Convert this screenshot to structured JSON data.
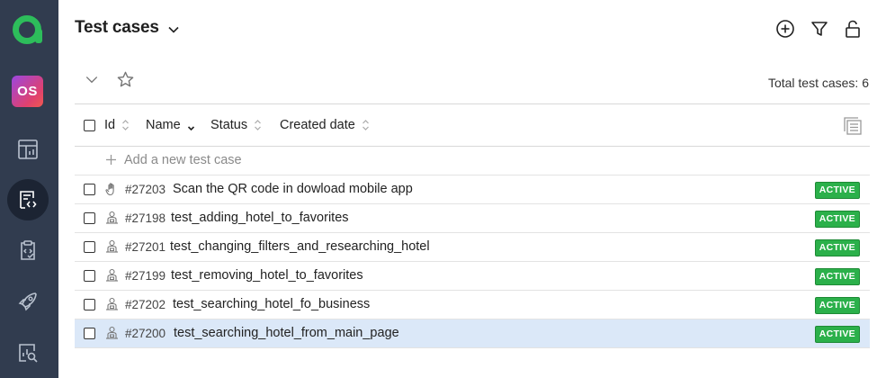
{
  "sidebar": {
    "avatar_initials": "OS",
    "brand_color": "#2dbd5b",
    "items": [
      {
        "icon": "dashboard-icon"
      },
      {
        "icon": "test-cases-icon",
        "active": true
      },
      {
        "icon": "test-plans-icon"
      },
      {
        "icon": "launches-icon"
      },
      {
        "icon": "analytics-search-icon"
      }
    ]
  },
  "header": {
    "title": "Test cases",
    "actions": [
      "add-icon",
      "filter-icon",
      "unlock-icon"
    ]
  },
  "toolbar": {
    "total_label": "Total test cases: 6"
  },
  "table": {
    "columns": [
      "Id",
      "Name",
      "Status",
      "Created date"
    ],
    "add_label": "Add a new test case",
    "rows": [
      {
        "id": "#27203",
        "name": "Scan the QR code in dowload mobile app",
        "status": "ACTIVE",
        "type": "manual"
      },
      {
        "id": "#27198",
        "name": "test_adding_hotel_to_favorites",
        "status": "ACTIVE",
        "type": "automated"
      },
      {
        "id": "#27201",
        "name": "test_changing_filters_and_researching_hotel",
        "status": "ACTIVE",
        "type": "automated"
      },
      {
        "id": "#27199",
        "name": "test_removing_hotel_to_favorites",
        "status": "ACTIVE",
        "type": "automated"
      },
      {
        "id": "#27202",
        "name": "test_searching_hotel_fo_business",
        "status": "ACTIVE",
        "type": "automated"
      },
      {
        "id": "#27200",
        "name": "test_searching_hotel_from_main_page",
        "status": "ACTIVE",
        "type": "automated",
        "selected": true
      }
    ]
  },
  "colors": {
    "sidebar_bg": "#313c4f",
    "active_badge": "#2bb04a",
    "selected_row": "#dbe8f8"
  }
}
